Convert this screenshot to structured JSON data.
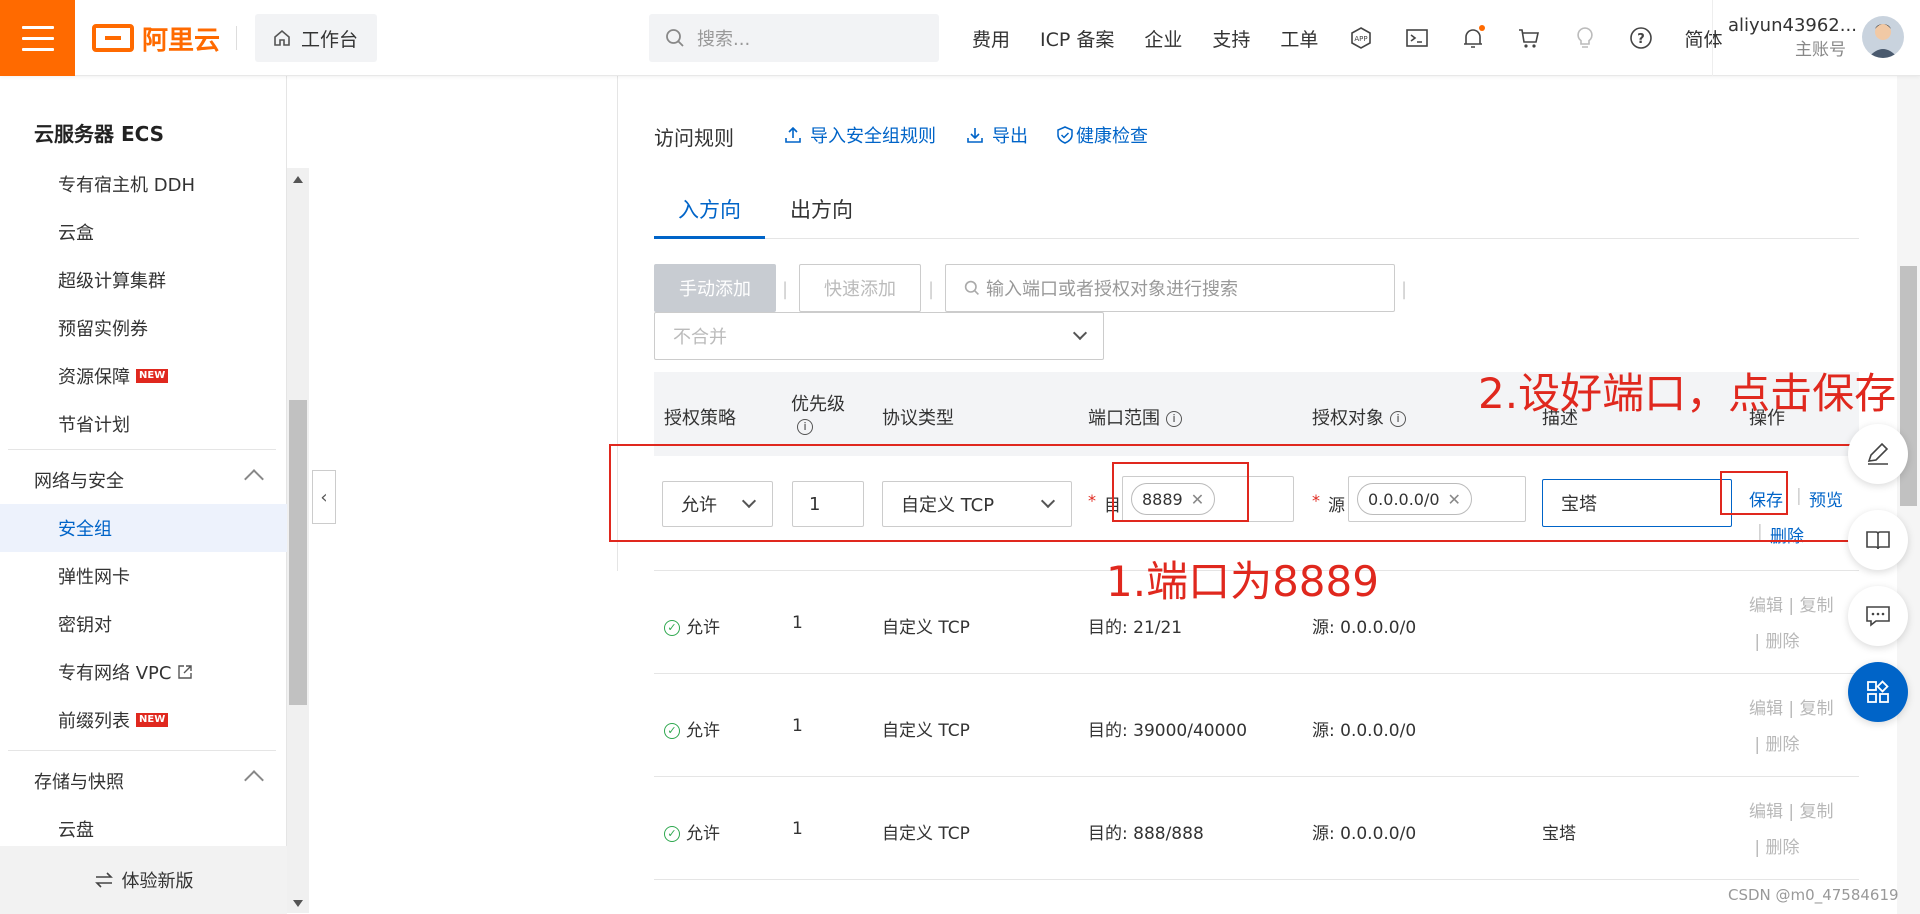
{
  "topbar": {
    "brand": "阿里云",
    "workbench": "工作台",
    "search_placeholder": "搜索...",
    "nav": [
      "费用",
      "ICP 备案",
      "企业",
      "支持",
      "工单"
    ],
    "lang": "简体",
    "username": "aliyun43962...",
    "account_type": "主账号"
  },
  "sidebar": {
    "title": "云服务器 ECS",
    "items_top": [
      "专有宿主机 DDH",
      "云盒",
      "超级计算集群",
      "预留实例券",
      "资源保障",
      "节省计划"
    ],
    "new_badge": "NEW",
    "group1": "网络与安全",
    "group1_items": [
      "安全组",
      "弹性网卡",
      "密钥对",
      "专有网络 VPC",
      "前缀列表"
    ],
    "group2": "存储与快照",
    "group2_items": [
      "云盘"
    ],
    "try_new": "体验新版"
  },
  "main": {
    "title": "访问规则",
    "import_label": "导入安全组规则",
    "export_label": "导出",
    "health_label": "健康检查",
    "tabs": [
      "入方向",
      "出方向"
    ],
    "manual_add": "手动添加",
    "quick_add": "快速添加",
    "search_placeholder": "输入端口或者授权对象进行搜索",
    "merge_select": "不合并",
    "headers": [
      "授权策略",
      "优先级",
      "协议类型",
      "端口范围",
      "授权对象",
      "描述",
      "操作"
    ],
    "edit_row": {
      "policy": "允许",
      "priority": "1",
      "protocol": "自定义 TCP",
      "dest_prefix": "目",
      "port": "8889",
      "src_prefix": "源",
      "source": "0.0.0.0/0",
      "desc": "宝塔",
      "save": "保存",
      "preview": "预览",
      "delete": "删除"
    },
    "rows": [
      {
        "policy": "允许",
        "priority": "1",
        "protocol": "自定义 TCP",
        "port": "目的: 21/21",
        "source": "源: 0.0.0.0/0",
        "desc": ""
      },
      {
        "policy": "允许",
        "priority": "1",
        "protocol": "自定义 TCP",
        "port": "目的: 39000/40000",
        "source": "源: 0.0.0.0/0",
        "desc": ""
      },
      {
        "policy": "允许",
        "priority": "1",
        "protocol": "自定义 TCP",
        "port": "目的: 888/888",
        "source": "源: 0.0.0.0/0",
        "desc": "宝塔"
      }
    ],
    "ops": {
      "edit": "编辑",
      "copy": "复制",
      "delete": "删除"
    }
  },
  "annotations": {
    "step1": "1.端口为8889",
    "step2": "2.设好端口，点击保存"
  },
  "watermark": "CSDN @m0_47584619"
}
